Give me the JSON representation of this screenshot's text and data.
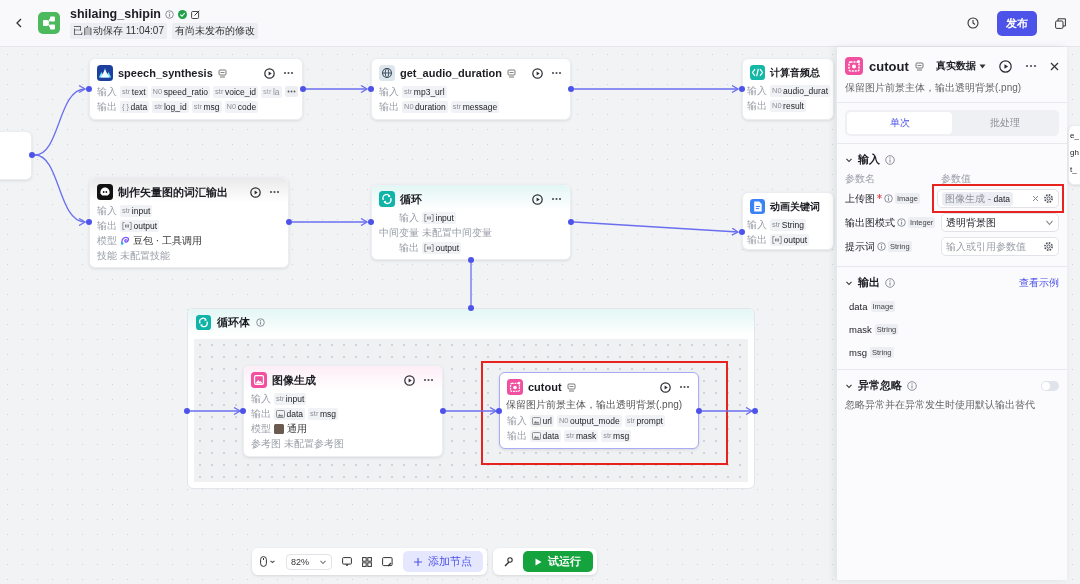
{
  "header": {
    "title": "shilaing_shipin",
    "autosave": "已自动保存 11:04:07",
    "status": "有尚未发布的修改",
    "publish": "发布"
  },
  "canvas": {
    "nodes": [
      {
        "kind": "stub"
      },
      {
        "kind": "plugin",
        "title": "speech_synthesis",
        "color": "#1d3f9e",
        "selected": false,
        "rows": [
          {
            "kind": "params",
            "label": "输入",
            "params": [
              {
                "kind": "text",
                "prefix": "str",
                "name": "text"
              },
              {
                "kind": "text",
                "prefix": "N0",
                "name": "speed_ratio"
              },
              {
                "kind": "text",
                "prefix": "str",
                "name": "voice_id"
              }
            ],
            "overflow": {
              "prefix": "str",
              "name": "la"
            }
          },
          {
            "kind": "params",
            "label": "输出",
            "params": [
              {
                "kind": "text",
                "prefix": "{ }",
                "name": "data"
              },
              {
                "kind": "text",
                "prefix": "str",
                "name": "log_id"
              },
              {
                "kind": "text",
                "prefix": "str",
                "name": "msg"
              },
              {
                "kind": "text",
                "prefix": "N0",
                "name": "code"
              }
            ]
          }
        ]
      },
      {
        "kind": "plugin",
        "title": "get_audio_duration",
        "color": "#dde6ec",
        "selected": false,
        "rows": [
          {
            "kind": "params",
            "label": "输入",
            "params": [
              {
                "kind": "text",
                "prefix": "str",
                "name": "mp3_url"
              }
            ]
          },
          {
            "kind": "params",
            "label": "输出",
            "params": [
              {
                "kind": "text",
                "prefix": "N0",
                "name": "duration"
              },
              {
                "kind": "text",
                "prefix": "str",
                "name": "message"
              }
            ]
          }
        ]
      },
      {
        "kind": "code",
        "title": "计算音频总",
        "color": "#14b8a6",
        "selected": false,
        "rows": [
          {
            "kind": "params",
            "label": "输入",
            "params": [
              {
                "kind": "text",
                "prefix": "N0",
                "name": "audio_durat"
              }
            ]
          },
          {
            "kind": "params",
            "label": "输出",
            "params": [
              {
                "kind": "text",
                "prefix": "N0",
                "name": "result"
              }
            ]
          }
        ]
      },
      {
        "kind": "llm",
        "title": "制作矢量图的词汇输出",
        "color": "#111111",
        "selected": false,
        "rows": [
          {
            "kind": "params",
            "label": "输入",
            "params": [
              {
                "kind": "text",
                "prefix": "str",
                "name": "input"
              }
            ]
          },
          {
            "kind": "params",
            "label": "输出",
            "params": [
              {
                "kind": "array",
                "name": "output"
              }
            ]
          },
          {
            "kind": "model",
            "label": "模型",
            "value": "豆包 · 工具调用"
          },
          {
            "kind": "empty",
            "label": "技能",
            "value": "未配置技能"
          }
        ]
      },
      {
        "kind": "loop",
        "title": "循环",
        "color": "#10b3a8",
        "selected": false,
        "rows": [
          {
            "kind": "params",
            "label": "输入",
            "params": [
              {
                "kind": "array",
                "name": "input"
              }
            ]
          },
          {
            "kind": "empty",
            "label": "中间变量",
            "value": "未配置中间变量"
          },
          {
            "kind": "params",
            "label": "输出",
            "params": [
              {
                "kind": "array",
                "name": "output"
              }
            ]
          }
        ]
      },
      {
        "kind": "plugin",
        "title": "动画关键词",
        "color": "#3b82f6",
        "selected": false,
        "rows": [
          {
            "kind": "params",
            "label": "输入",
            "params": [
              {
                "kind": "text",
                "prefix": "str",
                "name": "String"
              }
            ]
          },
          {
            "kind": "params",
            "label": "输出",
            "params": [
              {
                "kind": "array",
                "name": "output"
              }
            ]
          }
        ]
      },
      {
        "kind": "fragment",
        "lines": [
          "e_",
          "gh",
          "t_"
        ]
      }
    ],
    "loop_body": {
      "title": "循环体",
      "nodes": [
        {
          "kind": "image",
          "title": "图像生成",
          "color": "#f0509f",
          "selected": false,
          "rows": [
            {
              "kind": "params",
              "label": "输入",
              "params": [
                {
                  "kind": "text",
                  "prefix": "str",
                  "name": "input"
                }
              ]
            },
            {
              "kind": "params",
              "label": "输出",
              "params": [
                {
                  "kind": "image",
                  "name": "data"
                },
                {
                  "kind": "text",
                  "prefix": "str",
                  "name": "msg"
                }
              ]
            },
            {
              "kind": "model",
              "label": "模型",
              "value": "通用"
            },
            {
              "kind": "empty",
              "label": "参考图",
              "value": "未配置参考图"
            }
          ]
        },
        {
          "kind": "plugin",
          "title": "cutout",
          "color": "#f0509f",
          "selected": true,
          "description": "保留图片前景主体，输出透明背景(.png)",
          "rows": [
            {
              "kind": "params",
              "label": "输入",
              "params": [
                {
                  "kind": "image",
                  "name": "url"
                },
                {
                  "kind": "text",
                  "prefix": "N0",
                  "name": "output_mode"
                },
                {
                  "kind": "text",
                  "prefix": "str",
                  "name": "prompt"
                }
              ]
            },
            {
              "kind": "params",
              "label": "输出",
              "params": [
                {
                  "kind": "image",
                  "name": "data"
                },
                {
                  "kind": "text",
                  "prefix": "str",
                  "name": "mask"
                },
                {
                  "kind": "text",
                  "prefix": "str",
                  "name": "msg"
                }
              ]
            }
          ]
        }
      ]
    }
  },
  "panel": {
    "title": "cutout",
    "color": "#f0509f",
    "description": "保留图片前景主体，输出透明背景(.png)",
    "data_source": "真实数据",
    "tabs": [
      {
        "label": "单次",
        "selected": true
      },
      {
        "label": "批处理",
        "selected": false
      }
    ],
    "inputs": {
      "title": "输入",
      "column_1": "参数名",
      "column_2": "参数值",
      "params": [
        {
          "name": "上传图",
          "required": true,
          "type": "Image",
          "kind": "reference",
          "ref_node": "图像生成 -",
          "ref_var": "data"
        },
        {
          "name": "输出图模式",
          "required": false,
          "type": "Integer",
          "kind": "select",
          "value": "透明背景图"
        },
        {
          "name": "提示词",
          "required": false,
          "type": "String",
          "kind": "text",
          "placeholder": "输入或引用参数值"
        }
      ]
    },
    "outputs": {
      "title": "输出",
      "link": "查看示例",
      "params": [
        {
          "name": "data",
          "type": "Image"
        },
        {
          "name": "mask",
          "type": "String"
        },
        {
          "name": "msg",
          "type": "String"
        }
      ]
    },
    "error_handling": {
      "title": "异常忽略",
      "on": false,
      "description": "忽略异常并在异常发生时使用默认输出替代"
    }
  },
  "toolbar": {
    "zoom": "82%",
    "add_node": "添加节点",
    "run": "试运行"
  }
}
